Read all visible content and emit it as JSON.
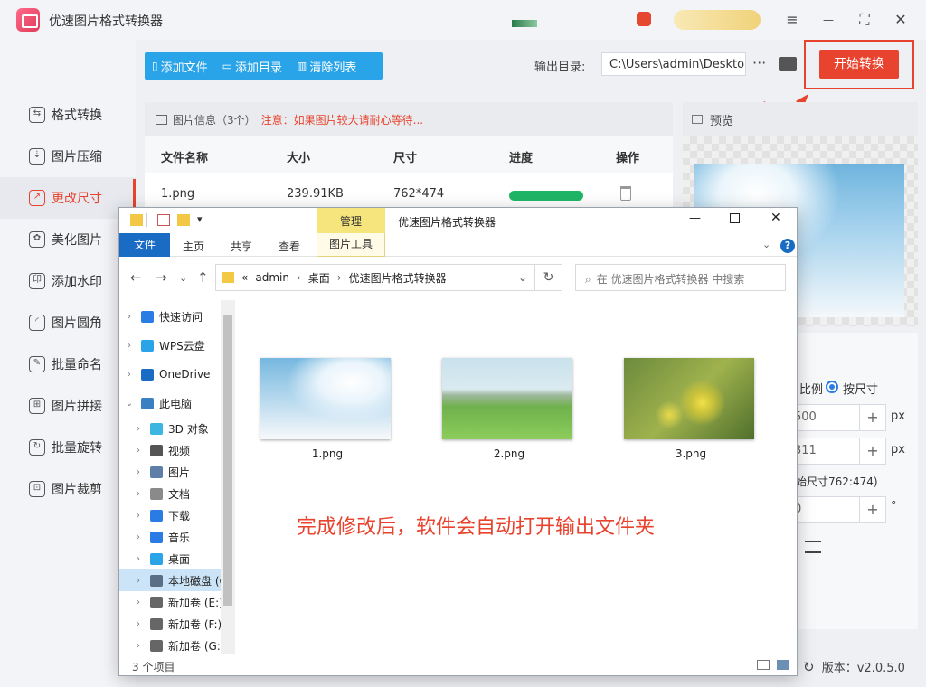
{
  "app": {
    "title": "优速图片格式转换器"
  },
  "window_controls": {
    "menu": "≡",
    "minimize": "—",
    "maximize": "⛶",
    "close": "✕"
  },
  "sidebar": {
    "items": [
      {
        "label": "格式转换",
        "icon": "format-convert-icon",
        "glyph": "⇆"
      },
      {
        "label": "图片压缩",
        "icon": "compress-icon",
        "glyph": "⇣"
      },
      {
        "label": "更改尺寸",
        "icon": "resize-icon",
        "glyph": "↗"
      },
      {
        "label": "美化图片",
        "icon": "beautify-icon",
        "glyph": "✿"
      },
      {
        "label": "添加水印",
        "icon": "watermark-icon",
        "glyph": "印"
      },
      {
        "label": "图片圆角",
        "icon": "rounded-corner-icon",
        "glyph": "◜"
      },
      {
        "label": "批量命名",
        "icon": "rename-icon",
        "glyph": "✎"
      },
      {
        "label": "图片拼接",
        "icon": "stitch-icon",
        "glyph": "⊞"
      },
      {
        "label": "批量旋转",
        "icon": "rotate-icon",
        "glyph": "↻"
      },
      {
        "label": "图片裁剪",
        "icon": "crop-icon",
        "glyph": "⊡"
      }
    ],
    "active_index": 2
  },
  "toolbar": {
    "add_file": "添加文件",
    "add_folder": "添加目录",
    "clear_list": "清除列表",
    "output_label": "输出目录:",
    "output_path": "C:\\Users\\admin\\Deskto",
    "more": "···",
    "start": "开始转换"
  },
  "file_list": {
    "info": "图片信息（3个）",
    "warning": "注意：如果图片较大请耐心等待...",
    "columns": [
      "文件名称",
      "大小",
      "尺寸",
      "进度",
      "操作"
    ],
    "rows": [
      {
        "name": "1.png",
        "size": "239.91KB",
        "dimensions": "762*474",
        "progress": 1.0
      }
    ]
  },
  "preview": {
    "label": "预览"
  },
  "settings": {
    "ratio_label": "比例",
    "by_size_label": "按尺寸",
    "width_value": "500",
    "height_value": "311",
    "px": "px",
    "original_size": "始尺寸762:474)",
    "rotate_value": "0",
    "degree": "°",
    "plus": "+"
  },
  "version": {
    "label": "版本：v2.0.5.0"
  },
  "explorer": {
    "title": "优速图片格式转换器",
    "manage_tab": "管理",
    "image_tools_tab": "图片工具",
    "ribbon_tabs": [
      "文件",
      "主页",
      "共享",
      "查看"
    ],
    "address_parts": [
      "admin",
      "桌面",
      "优速图片格式转换器"
    ],
    "search_placeholder": "在 优速图片格式转换器 中搜索",
    "nav_items": [
      {
        "label": "快速访问",
        "indent": 0,
        "color": "#2b7be4"
      },
      {
        "label": "WPS云盘",
        "indent": 0,
        "color": "#2aa4e9"
      },
      {
        "label": "OneDrive",
        "indent": 0,
        "color": "#1a6bc4"
      },
      {
        "label": "此电脑",
        "indent": 0,
        "color": "#3a7fc1",
        "expanded": true
      },
      {
        "label": "3D 对象",
        "indent": 1,
        "color": "#3bb6e0"
      },
      {
        "label": "视频",
        "indent": 1,
        "color": "#555555"
      },
      {
        "label": "图片",
        "indent": 1,
        "color": "#5d7fa8"
      },
      {
        "label": "文档",
        "indent": 1,
        "color": "#8a8a8a"
      },
      {
        "label": "下载",
        "indent": 1,
        "color": "#2b7be4"
      },
      {
        "label": "音乐",
        "indent": 1,
        "color": "#2b7be4"
      },
      {
        "label": "桌面",
        "indent": 1,
        "color": "#2aa4e9"
      },
      {
        "label": "本地磁盘 (C:)",
        "indent": 1,
        "color": "#5a6f85",
        "selected": true
      },
      {
        "label": "新加卷 (E:)",
        "indent": 1,
        "color": "#666666"
      },
      {
        "label": "新加卷 (F:)",
        "indent": 1,
        "color": "#666666"
      },
      {
        "label": "新加卷 (G:)",
        "indent": 1,
        "color": "#666666"
      }
    ],
    "files": [
      "1.png",
      "2.png",
      "3.png"
    ],
    "message": "完成修改后，软件会自动打开输出文件夹",
    "status": "3 个项目"
  },
  "colors": {
    "accent": "#e8432e",
    "toolbar_blue": "#2aa4e9",
    "progress_green": "#1fb567"
  }
}
